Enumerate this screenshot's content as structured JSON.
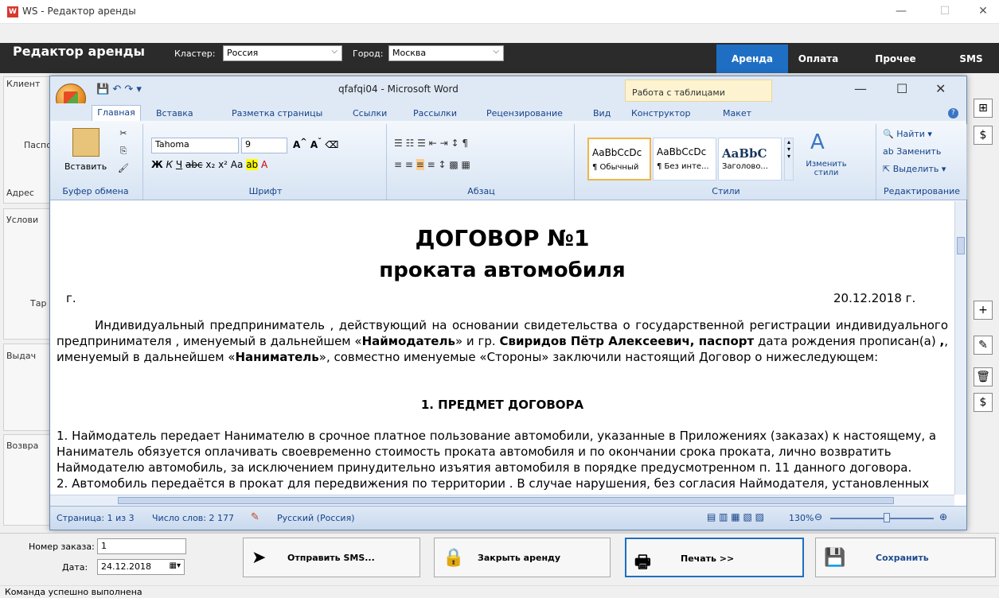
{
  "window": {
    "title": "WS - Редактор аренды",
    "app_icon": "W",
    "minimize": "—",
    "maximize": "☐",
    "close": "✕"
  },
  "app_header": {
    "title": "Редактор аренды",
    "cluster_label": "Кластер:",
    "cluster_value": "Россия",
    "city_label": "Город:",
    "city_value": "Москва",
    "tabs": [
      "Аренда",
      "Оплата",
      "Прочее",
      "SMS"
    ],
    "active_tab_color": "#1e6fc4"
  },
  "left_panel": {
    "labels": [
      "Клиент",
      "Паспо",
      "Адрес",
      "Услови",
      "Тар",
      "Выдач",
      "Возвра"
    ]
  },
  "sidebar_icons": [
    "table-edit-icon",
    "dollar-icon",
    "plus-icon",
    "pencil-icon",
    "trash-icon",
    "dollar-icon"
  ],
  "word": {
    "title": "qfafqi04 - Microsoft Word",
    "context_group": "Работа с таблицами",
    "tabs": [
      "Главная",
      "Вставка",
      "Разметка страницы",
      "Ссылки",
      "Рассылки",
      "Рецензирование",
      "Вид",
      "Конструктор",
      "Макет"
    ],
    "ribbon": {
      "paste_label": "Вставить",
      "clipboard_group": "Буфер обмена",
      "font_name": "Tahoma",
      "font_size": "9",
      "font_group": "Шрифт",
      "paragraph_group": "Абзац",
      "styles": [
        {
          "preview": "AaBbCcDc",
          "name": "¶ Обычный"
        },
        {
          "preview": "AaBbCcDc",
          "name": "¶ Без инте..."
        },
        {
          "preview": "AaBbC",
          "name": "Заголово..."
        }
      ],
      "change_styles": "Изменить стили",
      "styles_group": "Стили",
      "find": "Найти",
      "replace": "Заменить",
      "select": "Выделить",
      "editing_group": "Редактирование"
    },
    "document": {
      "title1": "ДОГОВОР №1",
      "title2": "проката автомобиля",
      "city": "г.",
      "date": "20.12.2018 г.",
      "para1_a": "Индивидуальный предприниматель , действующий на основании свидетельства о государственной регистрации индивидуального предпринимателя , именуемый в дальнейшем «",
      "para1_landlord": "Наймодатель",
      "para1_b": "» и гр. ",
      "para1_name": "Свиридов Пётр Алексеевич, паспорт",
      "para1_c": " дата рождения прописан(а) ",
      "para1_d": ", именуемый в дальнейшем «",
      "para1_tenant": "Наниматель",
      "para1_e": "», совместно именуемые «Стороны» заключили настоящий Договор о нижеследующем:",
      "section1": "1. ПРЕДМЕТ ДОГОВОРА",
      "item1": "1. Наймодатель передает Нанимателю в срочное платное пользование автомобили, указанные в Приложениях (заказах) к настоящему, а Наниматель обязуется оплачивать своевременно стоимость проката автомобиля и по окончании срока проката, лично возвратить Наймодателю автомобиль, за исключением принудительно изъятия автомобиля в порядке предусмотренном п. 11 данного договора.",
      "item2": "2. Автомобиль передаётся в прокат для передвижения по территории . В случае нарушения, без согласия Наймодателя, установленных"
    },
    "status": {
      "page": "Страница: 1 из 3",
      "words": "Число слов: 2 177",
      "language": "Русский (Россия)",
      "zoom": "130%"
    }
  },
  "bottom": {
    "order_label": "Номер заказа:",
    "order_value": "1",
    "date_label": "Дата:",
    "date_value": "24.12.2018",
    "btn_sms": "Отправить SMS...",
    "btn_close": "Закрыть аренду",
    "btn_print": "Печать  >>",
    "btn_save": "Сохранить",
    "status": "Команда успешно выполнена"
  }
}
